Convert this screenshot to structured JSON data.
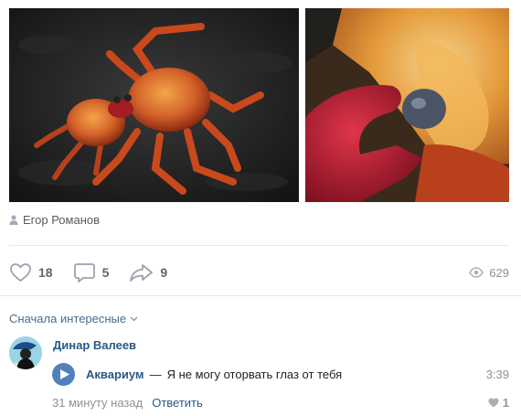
{
  "post": {
    "photos": [
      {
        "subject": "red crab on black volcanic rock"
      },
      {
        "subject": "close-up of crab claw"
      }
    ],
    "author": "Егор Романов",
    "actions": {
      "likes": "18",
      "comments": "5",
      "shares": "9",
      "views": "629"
    }
  },
  "comments_section": {
    "sort_label": "Сначала интересные",
    "comment": {
      "author": "Динар Валеев",
      "audio": {
        "artist": "Аквариум",
        "separator": "—",
        "title": "Я не могу оторвать глаз от тебя",
        "duration": "3:39"
      },
      "time": "31 минуту назад",
      "reply_label": "Ответить",
      "likes": "1"
    }
  },
  "colors": {
    "link": "#2a5885",
    "accent": "#5181b8",
    "muted": "#909090"
  }
}
